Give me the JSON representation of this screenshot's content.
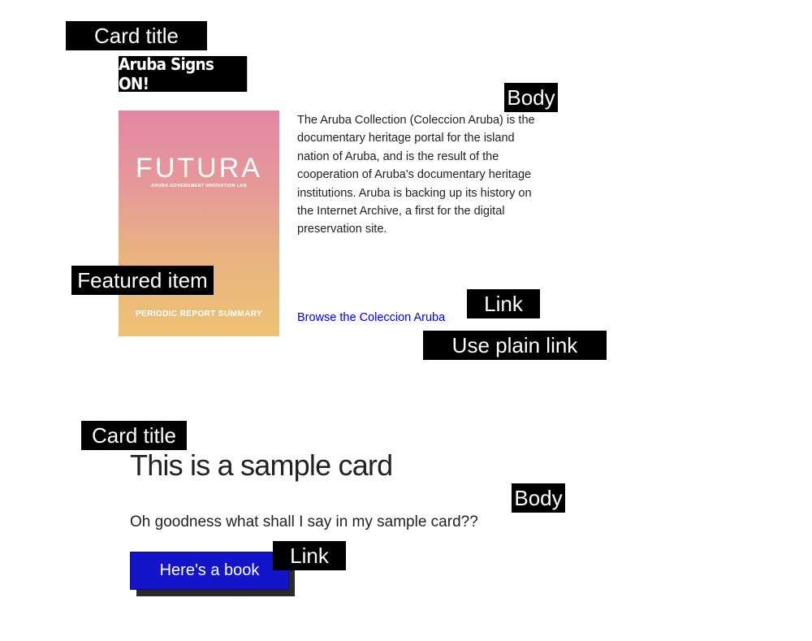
{
  "annotations": {
    "card_title_1": "Card title",
    "body_1": "Body",
    "featured_item": "Featured  item",
    "link_1": "Link",
    "use_plain_link": "Use plain link",
    "card_title_2": "Card title",
    "body_2": "Body",
    "link_2": "Link"
  },
  "card1": {
    "title": "Aruba Signs ON!",
    "cover": {
      "logo_text": "FUTURA",
      "subtitle": "ARUBA GOVERNMENT INNOVATION LAB",
      "footer": "PERIODIC REPORT SUMMARY",
      "gradient_top": "#e387a4",
      "gradient_bottom": "#eec272"
    },
    "body": "The Aruba Collection (Coleccion Aruba) is the documentary heritage portal for the island nation of Aruba, and is the result of the cooperation of Aruba's documentary heritage institutions. Aruba is backing up its history on the Internet Archive, a first for the digital preservation site.",
    "link_text": "Browse the Coleccion Aruba",
    "link_color": "#0000ee"
  },
  "card2": {
    "title": "This is a sample card",
    "body": "Oh goodness what shall I say in my sample card??",
    "button_label": "Here's a book",
    "button_color": "#1414c8",
    "button_shadow_color": "#2a2a2a"
  }
}
